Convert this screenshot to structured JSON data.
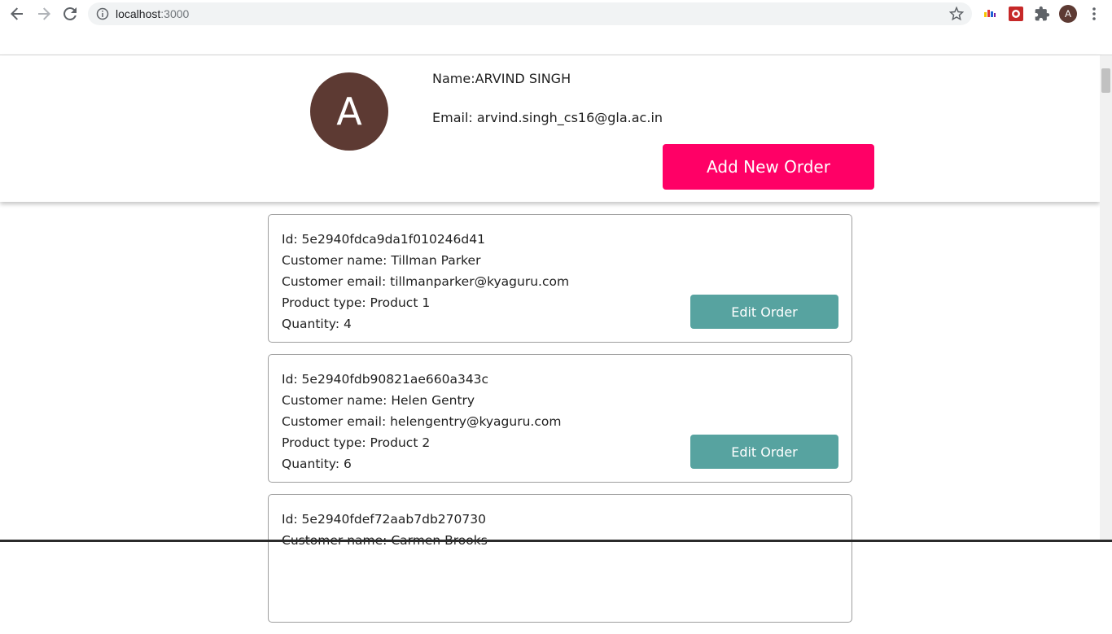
{
  "browser": {
    "url_host": "localhost",
    "url_port": ":3000",
    "profile_initial": "A",
    "icons": [
      "back-arrow-icon",
      "forward-arrow-icon",
      "reload-icon",
      "info-icon",
      "star-icon",
      "extension-icon",
      "puzzle-icon",
      "kebab-menu-icon"
    ]
  },
  "header": {
    "avatar_initial": "A",
    "name_text": "Name:ARVIND SINGH",
    "email_text": "Email: arvind.singh_cs16@gla.ac.in",
    "add_button_label": "Add New Order"
  },
  "orders": [
    {
      "id_text": "Id: 5e2940fdca9da1f010246d41",
      "customer_name_text": "Customer name: Tillman Parker",
      "customer_email_text": "Customer email: tillmanparker@kyaguru.com",
      "product_type_text": "Product type: Product 1",
      "quantity_text": "Quantity: 4",
      "edit_label": "Edit Order"
    },
    {
      "id_text": "Id: 5e2940fdb90821ae660a343c",
      "customer_name_text": "Customer name: Helen Gentry",
      "customer_email_text": "Customer email: helengentry@kyaguru.com",
      "product_type_text": "Product type: Product 2",
      "quantity_text": "Quantity: 6",
      "edit_label": "Edit Order"
    },
    {
      "id_text": "Id: 5e2940fdef72aab7db270730",
      "customer_name_text": "Customer name: Carmen Brooks"
    }
  ],
  "colors": {
    "accent_pink": "#ff0066",
    "edit_teal": "#57a3a0",
    "avatar_brown": "#5d3a33"
  }
}
